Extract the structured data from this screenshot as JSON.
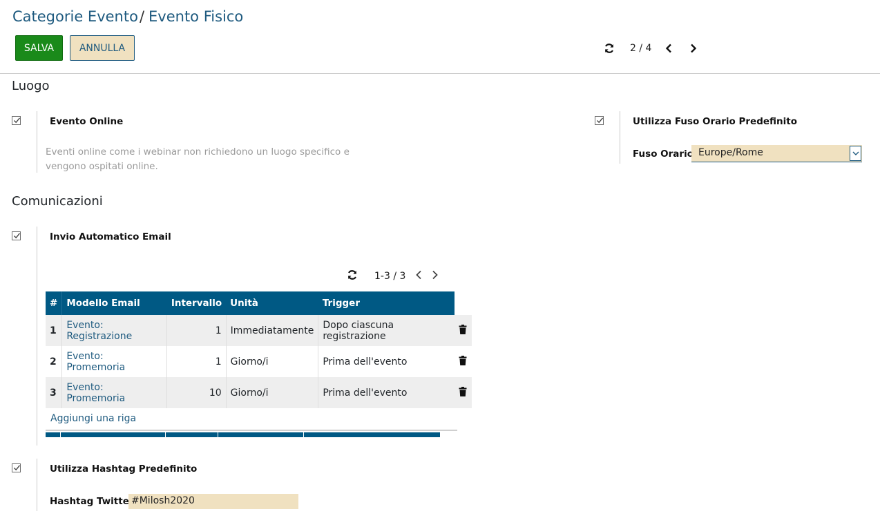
{
  "breadcrumb": {
    "parent": "Categorie Evento",
    "separator": "/",
    "current": "Evento Fisico"
  },
  "toolbar": {
    "save_label": "SALVA",
    "cancel_label": "ANNULLA"
  },
  "pager": {
    "text": "2 / 4"
  },
  "colors": {
    "primary": "#005984",
    "link": "#1e5a7f",
    "save": "#1a8a1a",
    "input_bg": "#f0e1c0"
  },
  "sections": {
    "location": {
      "title": "Luogo",
      "online_event": {
        "label": "Evento Online",
        "checked": true,
        "help": "Eventi online come i webinar non richiedono un luogo specifico e vengono ospitati online."
      },
      "default_tz": {
        "label": "Utilizza Fuso Orario Predefinito",
        "checked": true,
        "tz_label": "Fuso Orario",
        "tz_value": "Europe/Rome"
      }
    },
    "communications": {
      "title": "Comunicazioni",
      "auto_email": {
        "label": "Invio Automatico Email",
        "checked": true
      },
      "mail_pager": "1-3 / 3",
      "table": {
        "headers": [
          "#",
          "Modello Email",
          "Intervallo",
          "Unità",
          "Trigger"
        ],
        "rows": [
          {
            "num": "1",
            "template_line1": "Evento:",
            "template_line2": "Registrazione",
            "interval": "1",
            "unit": "Immediatamente",
            "trigger": "Dopo ciascuna registrazione"
          },
          {
            "num": "2",
            "template_line1": "Evento:",
            "template_line2": "Promemoria",
            "interval": "1",
            "unit": "Giorno/i",
            "trigger": "Prima dell'evento"
          },
          {
            "num": "3",
            "template_line1": "Evento:",
            "template_line2": "Promemoria",
            "interval": "10",
            "unit": "Giorno/i",
            "trigger": "Prima dell'evento"
          }
        ],
        "add_row_label": "Aggiungi una riga"
      },
      "hashtag": {
        "label": "Utilizza Hashtag Predefinito",
        "checked": true,
        "field_label": "Hashtag Twitter",
        "field_value": "#Milosh2020"
      }
    }
  }
}
